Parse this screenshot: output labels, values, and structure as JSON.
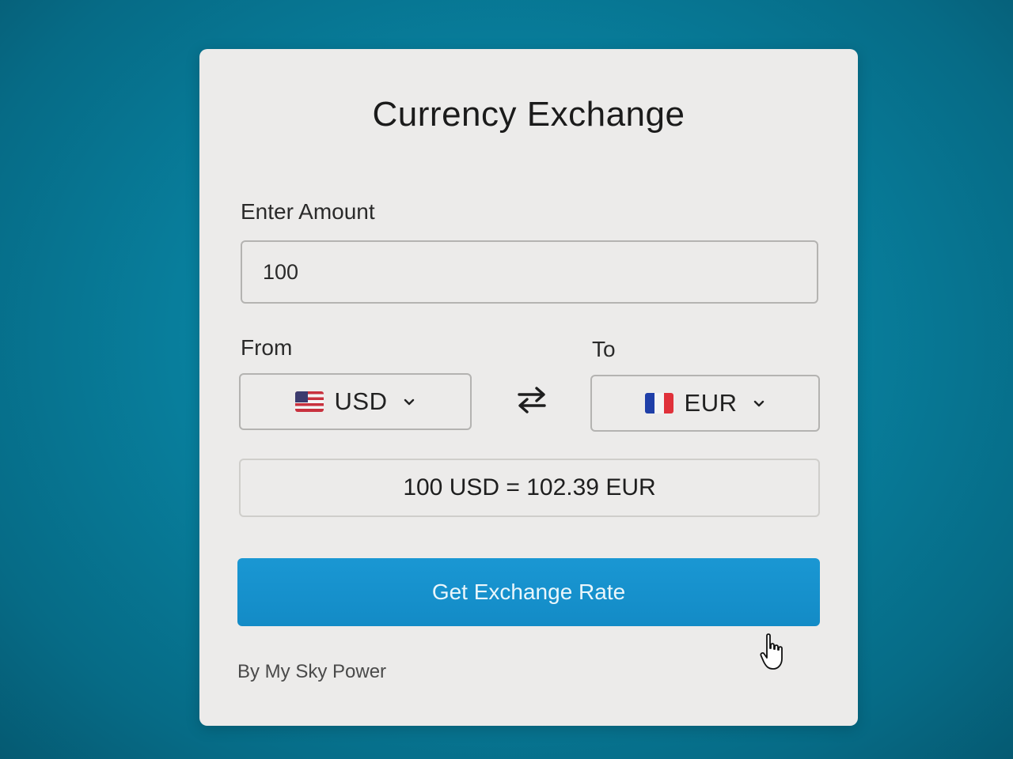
{
  "title": "Currency Exchange",
  "amount": {
    "label": "Enter Amount",
    "value": "100"
  },
  "from": {
    "label": "From",
    "flag_icon": "us-flag-icon",
    "currency": "USD"
  },
  "to": {
    "label": "To",
    "flag_icon": "fr-flag-icon",
    "currency": "EUR"
  },
  "swap_icon": "swap-arrows-icon",
  "result_text": "100 USD = 102.39 EUR",
  "button_label": "Get Exchange Rate",
  "footer": "By My Sky Power",
  "colors": {
    "background": "#0b8fb0",
    "card": "#ecebea",
    "button": "#1a97d3",
    "button_text": "#eaf6fb"
  }
}
